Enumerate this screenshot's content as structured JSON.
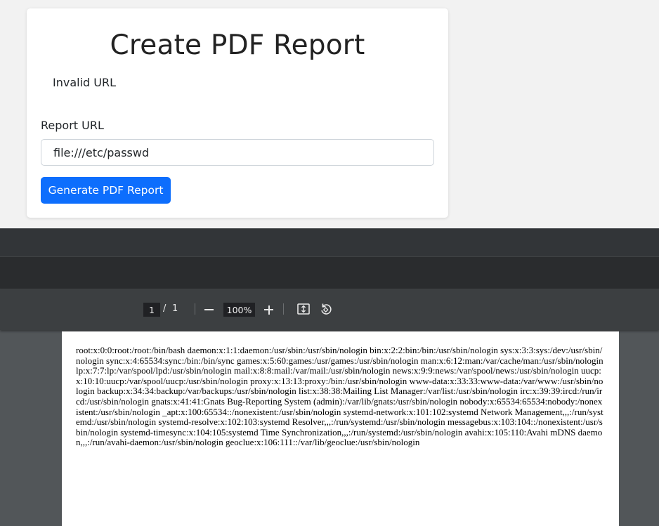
{
  "form": {
    "title": "Create PDF Report",
    "error_message": "Invalid URL",
    "url_label": "Report URL",
    "url_value": "file:///etc/passwd",
    "submit_label": "Generate PDF Report"
  },
  "viewer": {
    "current_page": "1",
    "page_separator": "/",
    "total_pages": "1",
    "zoom": "100%",
    "icons": [
      "zoom-out-icon",
      "zoom-in-icon",
      "fit-page-icon",
      "rotate-icon"
    ],
    "document_text": "root:x:0:0:root:/root:/bin/bash daemon:x:1:1:daemon:/usr/sbin:/usr/sbin/nologin bin:x:2:2:bin:/bin:/usr/sbin/nologin sys:x:3:3:sys:/dev:/usr/sbin/nologin sync:x:4:65534:sync:/bin:/bin/sync games:x:5:60:games:/usr/games:/usr/sbin/nologin man:x:6:12:man:/var/cache/man:/usr/sbin/nologin lp:x:7:7:lp:/var/spool/lpd:/usr/sbin/nologin mail:x:8:8:mail:/var/mail:/usr/sbin/nologin news:x:9:9:news:/var/spool/news:/usr/sbin/nologin uucp:x:10:10:uucp:/var/spool/uucp:/usr/sbin/nologin proxy:x:13:13:proxy:/bin:/usr/sbin/nologin www-data:x:33:33:www-data:/var/www:/usr/sbin/nologin backup:x:34:34:backup:/var/backups:/usr/sbin/nologin list:x:38:38:Mailing List Manager:/var/list:/usr/sbin/nologin irc:x:39:39:ircd:/run/ircd:/usr/sbin/nologin gnats:x:41:41:Gnats Bug-Reporting System (admin):/var/lib/gnats:/usr/sbin/nologin nobody:x:65534:65534:nobody:/nonexistent:/usr/sbin/nologin _apt:x:100:65534::/nonexistent:/usr/sbin/nologin systemd-network:x:101:102:systemd Network Management,,,:/run/systemd:/usr/sbin/nologin systemd-resolve:x:102:103:systemd Resolver,,,:/run/systemd:/usr/sbin/nologin messagebus:x:103:104::/nonexistent:/usr/sbin/nologin systemd-timesync:x:104:105:systemd Time Synchronization,,,:/run/systemd:/usr/sbin/nologin avahi:x:105:110:Avahi mDNS daemon,,,:/run/avahi-daemon:/usr/sbin/nologin geoclue:x:106:111::/var/lib/geoclue:/usr/sbin/nologin"
  },
  "colors": {
    "primary_button": "#0d6efd",
    "viewer_background": "#525659",
    "toolbar": "#3c3f41"
  }
}
